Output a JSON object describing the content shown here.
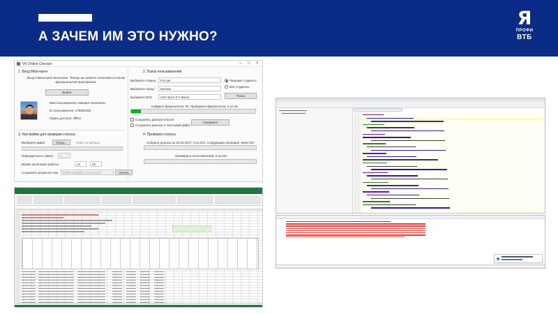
{
  "header": {
    "title": "А ЗАЧЕМ ИМ ЭТО НУЖНО?",
    "bg_color": "#0a2b86",
    "logo": {
      "mark": "Я",
      "line1": "ПРОФИ",
      "line2": "ВТБ"
    }
  },
  "vk_checker": {
    "window_title": "VK Online Checker",
    "section1": {
      "title": "1. Вход ВКонтакте",
      "info": "Вход в ВКонтакте выполнен. Теперь вы можете пользоваться всем функционалом приложения.",
      "login_button": "Выйти",
      "user_name": "Имя пользователя: Михаил Галиченко",
      "user_id": "ID пользователя: 175891252",
      "access": "Право доступа: offline"
    },
    "section2": {
      "title": "2. Поиск пользователей",
      "country_label": "Выберите страну:",
      "country_value": "Россия",
      "city_label": "Выберите город:",
      "city_value": "Москва",
      "university_label": "Выберите ВУЗ:",
      "university_value": "НИУ ВШЭ (ГУ-ВШЭ)",
      "radio_current": "Текущие студенты",
      "radio_all": "Все студенты",
      "search_button": "Поиск",
      "found_status": "Найдено факультетов: 25. Проверено факультетов: 2 из 25.",
      "progress_fraction": 0.08,
      "check_excel": "Сохранять данные в Excel",
      "check_txt": "Сохранять данные в текстовый файл",
      "save_button": "Сохранить"
    },
    "section3": {
      "title": "3. Настройки для проверки статуса",
      "file_label": "Выберите файл:",
      "browse_button": "Обзор...",
      "file_placeholder": "Файл не выбран",
      "period_label": "Периодичность (мин):",
      "period_value": "5",
      "end_time_label": "Время окончания работы:",
      "end_hours": "19",
      "end_minutes": "00",
      "save_result_label": "Сохранить результат как:",
      "save_result_value": "Online Statistics_15.05.2017",
      "start_button": "Начать"
    },
    "section4": {
      "title": "4. Проверка статуса",
      "collected": "Собрано данных за 15.05.2017: 0 из N/A. Следующая операция через N/A",
      "checked": "Проверено пользователей: 0 из N/A"
    }
  },
  "excel": {
    "accent": "#217346"
  },
  "ide": {
    "accent": "#dfe6ee",
    "highlight": "#fff7c2"
  },
  "console": {
    "error_color": "#e53935"
  }
}
